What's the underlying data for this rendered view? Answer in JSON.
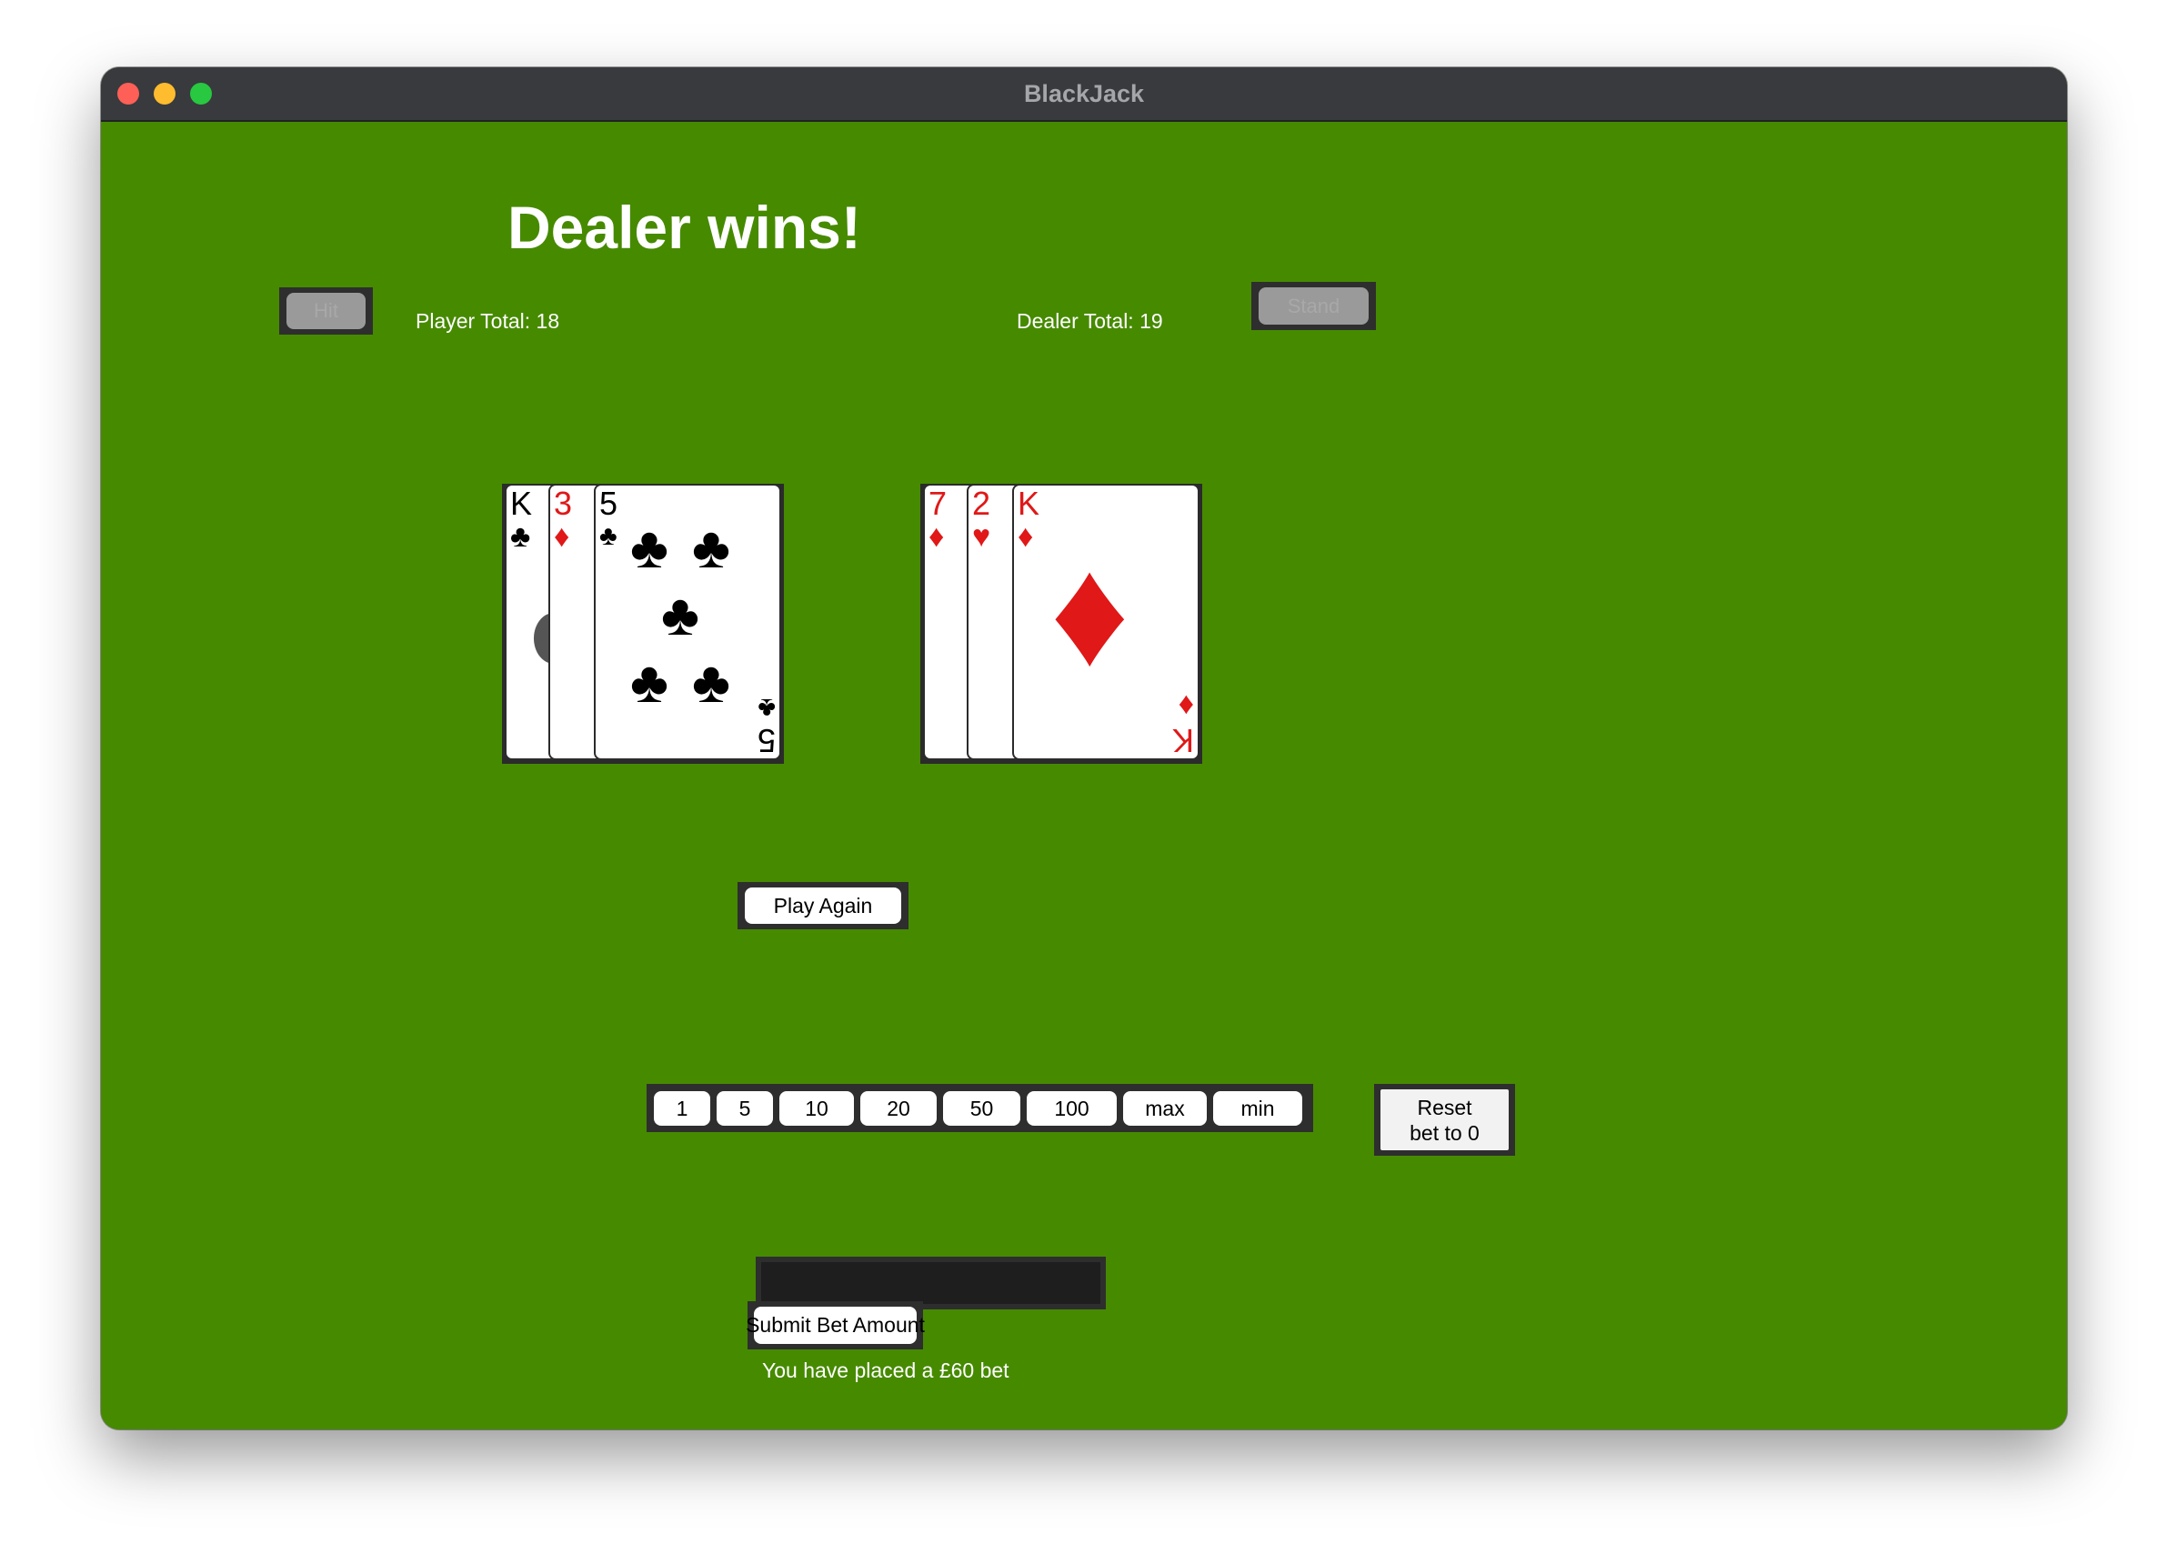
{
  "window": {
    "title": "BlackJack"
  },
  "game": {
    "result": "Dealer wins!",
    "hit_label": "Hit",
    "stand_label": "Stand",
    "player_total": "Player Total: 18",
    "dealer_total": "Dealer Total: 19",
    "play_again_label": "Play Again"
  },
  "player_cards": [
    {
      "rank": "K",
      "suit": "♣",
      "color": "black"
    },
    {
      "rank": "3",
      "suit": "♦",
      "color": "red"
    },
    {
      "rank": "5",
      "suit": "♣",
      "color": "black"
    }
  ],
  "dealer_cards": [
    {
      "rank": "7",
      "suit": "♦",
      "color": "red"
    },
    {
      "rank": "2",
      "suit": "♥",
      "color": "red"
    },
    {
      "rank": "K",
      "suit": "♦",
      "color": "red"
    }
  ],
  "betting": {
    "chips": [
      "1",
      "5",
      "10",
      "20",
      "50",
      "100",
      "max",
      "min"
    ],
    "reset_label": "Reset bet to 0",
    "input_value": "",
    "submit_label": "Submit Bet Amount",
    "status": "You have placed a £60 bet"
  },
  "colors": {
    "table": "#468a00",
    "red_suit": "#e01818",
    "frame": "#2e2e2e"
  }
}
